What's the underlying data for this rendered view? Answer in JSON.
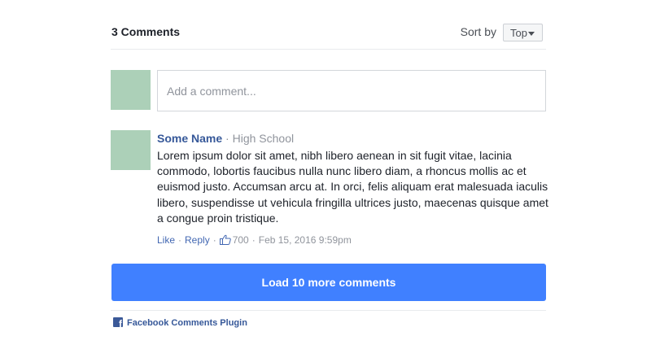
{
  "header": {
    "count_label": "3 Comments",
    "sort_label": "Sort by",
    "sort_value": "Top"
  },
  "composer": {
    "placeholder": "Add a comment..."
  },
  "comments": [
    {
      "author": "Some Name",
      "separator": "·",
      "meta": "High School",
      "text": "Lorem ipsum dolor sit amet, nibh libero aenean in sit fugit vitae, lacinia commodo, lobortis faucibus nulla nunc libero diam, a rhoncus mollis ac et euismod justo. Accumsan arcu at. In orci, felis aliquam erat malesuada iaculis libero, suspendisse ut vehicula fringilla ultrices justo, maecenas quisque amet a congue proin tristique.",
      "actions": {
        "like_label": "Like",
        "reply_label": "Reply",
        "like_count": "700",
        "timestamp": "Feb 15, 2016 9:59pm",
        "separator": "·"
      }
    }
  ],
  "load_more_label": "Load 10 more comments",
  "footer": {
    "plugin_label": "Facebook Comments Plugin",
    "icon": "facebook-icon"
  },
  "colors": {
    "link": "#365899",
    "action_link": "#4267b2",
    "button": "#4080ff",
    "avatar": "#acd0b8",
    "muted": "#90949c"
  }
}
